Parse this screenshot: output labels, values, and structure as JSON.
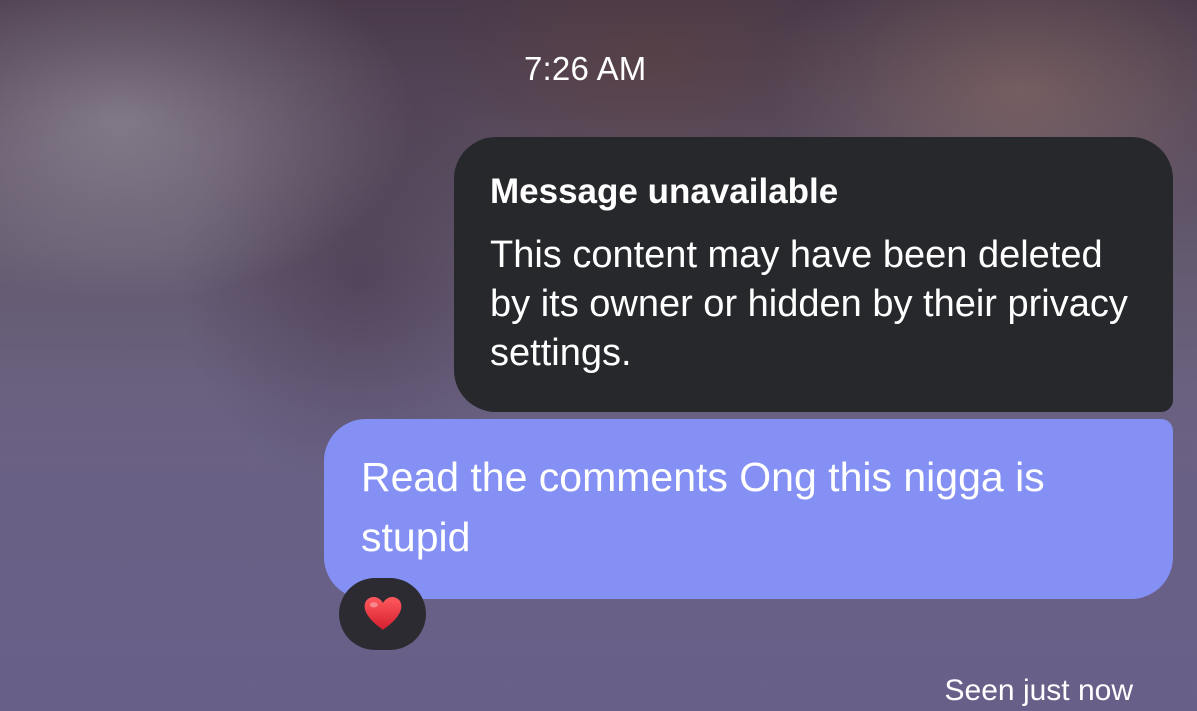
{
  "conversation": {
    "timestamp": "7:26 AM",
    "unavailable_message": {
      "title": "Message unavailable",
      "body": "This content may have been deleted by its owner or hidden by their privacy settings."
    },
    "sent_message": {
      "text": "Read the comments Ong this nigga is stupid",
      "reaction": "heart-icon"
    },
    "status": "Seen just now"
  },
  "colors": {
    "sent_bubble": "#8490f3",
    "received_bubble": "#26282c",
    "reaction_pill": "#2c2b31",
    "heart": "#e8283a"
  }
}
